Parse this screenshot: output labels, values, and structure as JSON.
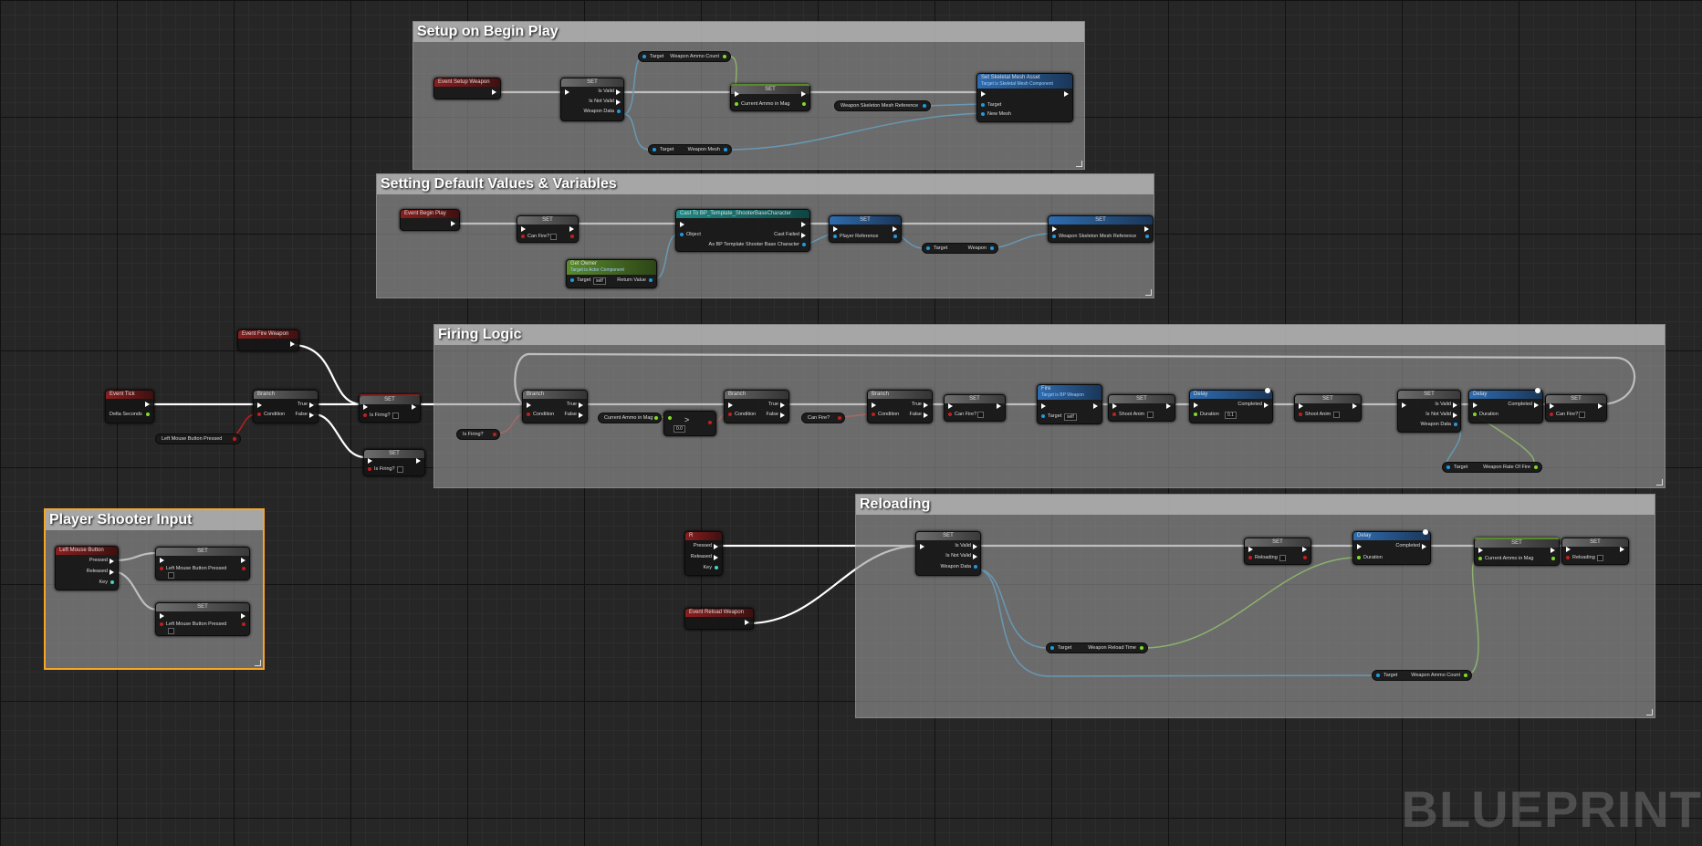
{
  "comments": {
    "setup_begin_play": "Setup on Begin Play",
    "default_values": "Setting Default Values & Variables",
    "firing_logic": "Firing Logic",
    "player_input": "Player Shooter Input",
    "reloading": "Reloading"
  },
  "setup": {
    "event_setup_weapon": "Event Setup Weapon",
    "set": "SET",
    "is_valid": "Is Valid",
    "is_not_valid": "Is Not Valid",
    "weapon_data": "Weapon Data",
    "target": "Target",
    "weapon_ammo_count": "Weapon Ammo Count",
    "current_ammo_in_mag": "Current Ammo in Mag",
    "weapon_skeleton_mesh_reference": "Weapon Skeleton Mesh Reference",
    "set_skeletal_mesh_asset": "Set Skeletal Mesh Asset",
    "set_skeletal_mesh_sub": "Target is Skeletal Mesh Component",
    "new_mesh": "New Mesh",
    "weapon_mesh": "Weapon Mesh"
  },
  "defaults": {
    "event_begin_play": "Event Begin Play",
    "can_fire": "Can Fire?",
    "cast_title": "Cast To BP_Template_ShooterBaseCharacter",
    "object": "Object",
    "cast_failed": "Cast Failed",
    "as_bp": "As BP Template Shooter Base Character",
    "get_owner": "Get Owner",
    "get_owner_sub": "Target is Actor Component",
    "self": "self",
    "return_value": "Return Value",
    "player_reference": "Player Reference",
    "weapon": "Weapon",
    "weapon_skeleton_mesh_reference": "Weapon Skeleton Mesh Reference"
  },
  "firing": {
    "event_fire_weapon": "Event Fire Weapon",
    "event_tick": "Event Tick",
    "delta_seconds": "Delta Seconds",
    "branch": "Branch",
    "condition": "Condition",
    "true": "True",
    "false": "False",
    "left_mouse_button_pressed": "Left Mouse Button Pressed",
    "is_firing": "Is Firing?",
    "current_ammo_in_mag": "Current Ammo in Mag",
    "compare_value": "0.0",
    "can_fire": "Can Fire?",
    "fire": "Fire",
    "fire_sub": "Target is BP Weapon",
    "shoot_anim": "Shoot Anim",
    "delay": "Delay",
    "completed": "Completed",
    "duration": "Duration",
    "duration_value": "0.1",
    "weapon_rate_of_fire": "Weapon Rate Of Fire"
  },
  "input": {
    "left_mouse_button": "Left Mouse Button",
    "pressed": "Pressed",
    "released": "Released",
    "key": "Key",
    "left_mouse_button_pressed": "Left Mouse Button Pressed"
  },
  "reload": {
    "key_r": "R",
    "event_reload_weapon": "Event Reload Weapon",
    "reloading": "Reloading",
    "weapon_reload_time": "Weapon Reload Time",
    "weapon_ammo_count": "Weapon Ammo Count"
  },
  "watermark": "BLUEPRINT"
}
